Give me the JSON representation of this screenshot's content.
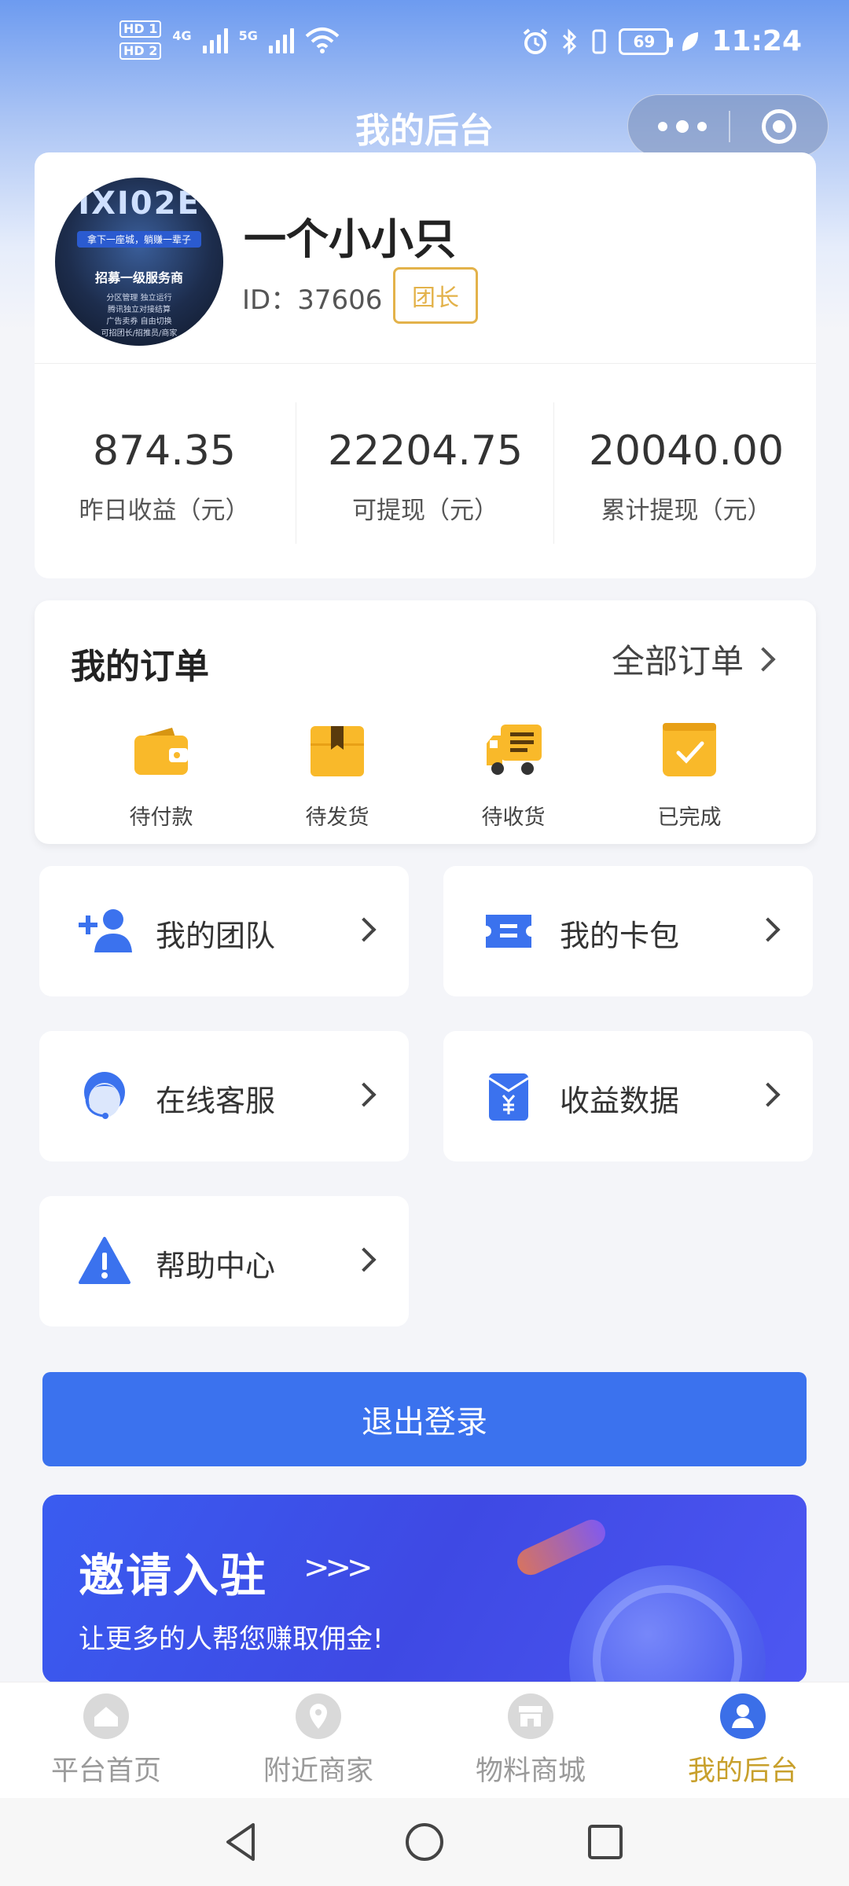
{
  "status_bar": {
    "hd1": "HD 1",
    "hd2": "HD 2",
    "net1": "4G",
    "net2": "5G",
    "battery": "69",
    "time": "11:24"
  },
  "header": {
    "title": "我的后台"
  },
  "avatar_image": {
    "line1": "ΙΧΙ02Ε",
    "line2": "拿下一座城，躺赚一辈子",
    "line3": "招募一级服务商",
    "line4": "分区管理 独立运行",
    "line5": "腾讯独立对接结算",
    "line6": "广告卖券 自由切换",
    "line7": "可招团长/招推员/商家"
  },
  "profile": {
    "name": "一个小小只",
    "id_text": "ID：37606",
    "role": "团长"
  },
  "stats": [
    {
      "value": "874.35",
      "label": "昨日收益（元）"
    },
    {
      "value": "22204.75",
      "label": "可提现（元）"
    },
    {
      "value": "20040.00",
      "label": "累计提现（元）"
    }
  ],
  "orders": {
    "title": "我的订单",
    "all_label": "全部订单",
    "items": [
      {
        "label": "待付款",
        "icon": "wallet-icon"
      },
      {
        "label": "待发货",
        "icon": "package-icon"
      },
      {
        "label": "待收货",
        "icon": "truck-icon"
      },
      {
        "label": "已完成",
        "icon": "completed-icon"
      }
    ]
  },
  "menu": [
    {
      "label": "我的团队",
      "icon": "add-user-icon"
    },
    {
      "label": "我的卡包",
      "icon": "ticket-icon"
    },
    {
      "label": "在线客服",
      "icon": "customer-service-icon"
    },
    {
      "label": "收益数据",
      "icon": "income-icon"
    },
    {
      "label": "帮助中心",
      "icon": "warning-icon"
    }
  ],
  "logout_label": "退出登录",
  "invite": {
    "title": "邀请入驻",
    "arrows": ">>>",
    "subtitle": "让更多的人帮您赚取佣金!"
  },
  "tabs": [
    {
      "label": "平台首页",
      "icon": "home-icon",
      "active": false
    },
    {
      "label": "附近商家",
      "icon": "location-icon",
      "active": false
    },
    {
      "label": "物料商城",
      "icon": "store-icon",
      "active": false
    },
    {
      "label": "我的后台",
      "icon": "profile-icon",
      "active": true
    }
  ],
  "colors": {
    "primary": "#3b72ee",
    "accent_gold": "#e3b24a",
    "order_icon_yellow": "#f9b92a",
    "tab_active_label": "#c8a02c"
  }
}
